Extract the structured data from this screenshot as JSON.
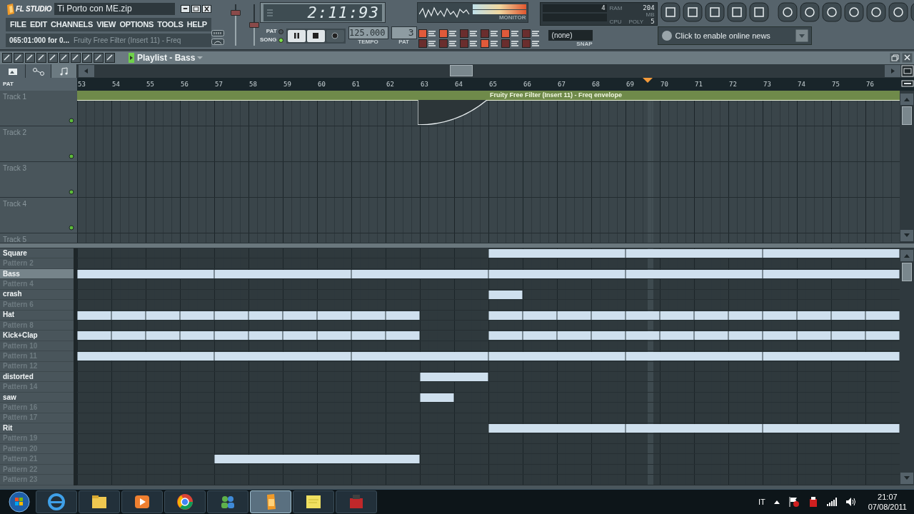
{
  "window": {
    "title": "Ti Porto con ME.zip"
  },
  "logo": "FL STUDIO",
  "menu": [
    "FILE",
    "EDIT",
    "CHANNELS",
    "VIEW",
    "OPTIONS",
    "TOOLS",
    "HELP"
  ],
  "hint": {
    "position": "065:01:000 for 0...",
    "message": "Fruity Free Filter (Insert 11) - Freq"
  },
  "sliders": [
    {
      "level": 0.8
    },
    {
      "level": 0.5
    }
  ],
  "time_display": "2:11:93",
  "mode": [
    {
      "label": "PAT",
      "selected": false
    },
    {
      "label": "SONG",
      "selected": true
    }
  ],
  "tempo": {
    "value": "125.000",
    "label": "TEMPO"
  },
  "pattern": {
    "value": "3",
    "label": "PAT"
  },
  "monitor": {
    "label": "MONITOR"
  },
  "stats": {
    "volume": "4",
    "ram_label": "RAM",
    "ram_unit": "MB",
    "ram_value": "204",
    "cpu_label": "CPU",
    "poly_label": "POLY",
    "poly_value": "5"
  },
  "snap": {
    "value": "(none)",
    "label": "SNAP"
  },
  "news": {
    "text": "Click to enable online news"
  },
  "playlist": {
    "title": "Playlist - Bass",
    "view_tabs": [
      {
        "kind": "picture",
        "selected": false
      },
      {
        "kind": "automation",
        "selected": false
      },
      {
        "kind": "note",
        "selected": true
      }
    ],
    "mode_label": "PAT",
    "ruler": [
      "53",
      "54",
      "55",
      "56",
      "57",
      "58",
      "59",
      "60",
      "61",
      "62",
      "63",
      "64",
      "65",
      "66",
      "67",
      "68",
      "69",
      "70",
      "71",
      "72",
      "73",
      "74",
      "75",
      "76"
    ],
    "playhead": {
      "level": 0.694
    },
    "tracks": [
      {
        "name": "Track 1",
        "bars": [
          {
            "kind": "start"
          },
          {
            "kind": "more"
          },
          {
            "kind": "more"
          },
          {
            "kind": "more"
          },
          {
            "kind": "more"
          },
          {
            "kind": "more"
          },
          {
            "kind": "more"
          },
          {
            "kind": "more"
          },
          {
            "kind": "more"
          },
          {
            "kind": "more"
          },
          {
            "kind": "more"
          },
          {
            "kind": "more"
          },
          {
            "kind": "start",
            "label": "Fruity Free Filter (Insert 11) - Freq envelope"
          },
          {
            "kind": "more"
          },
          {
            "kind": "more"
          },
          {
            "kind": "more"
          },
          {
            "kind": "more"
          },
          {
            "kind": "more"
          },
          {
            "kind": "more"
          },
          {
            "kind": "more"
          },
          {
            "kind": "more"
          },
          {
            "kind": "more"
          },
          {
            "kind": "more"
          },
          {
            "kind": "more"
          }
        ]
      },
      {
        "name": "Track 2"
      },
      {
        "name": "Track 3"
      },
      {
        "name": "Track 4"
      },
      {
        "name": "Track 5"
      }
    ],
    "patterns": [
      {
        "name": "Square",
        "named": true,
        "selected": false,
        "bars": [
          {
            "kind": "empty"
          },
          {
            "kind": "empty"
          },
          {
            "kind": "empty"
          },
          {
            "kind": "empty"
          },
          {
            "kind": "empty"
          },
          {
            "kind": "empty"
          },
          {
            "kind": "empty"
          },
          {
            "kind": "empty"
          },
          {
            "kind": "empty"
          },
          {
            "kind": "empty"
          },
          {
            "kind": "empty"
          },
          {
            "kind": "empty"
          },
          {
            "kind": "start"
          },
          {
            "kind": "more"
          },
          {
            "kind": "more"
          },
          {
            "kind": "more"
          },
          {
            "kind": "start"
          },
          {
            "kind": "more"
          },
          {
            "kind": "more"
          },
          {
            "kind": "more"
          },
          {
            "kind": "start"
          },
          {
            "kind": "more"
          },
          {
            "kind": "more"
          },
          {
            "kind": "more"
          }
        ]
      },
      {
        "name": "Pattern 2",
        "named": false,
        "selected": false
      },
      {
        "name": "Bass",
        "named": true,
        "selected": true,
        "bars": [
          {
            "kind": "start"
          },
          {
            "kind": "more"
          },
          {
            "kind": "more"
          },
          {
            "kind": "more"
          },
          {
            "kind": "start"
          },
          {
            "kind": "more"
          },
          {
            "kind": "more"
          },
          {
            "kind": "more"
          },
          {
            "kind": "start"
          },
          {
            "kind": "more"
          },
          {
            "kind": "more"
          },
          {
            "kind": "more"
          },
          {
            "kind": "start"
          },
          {
            "kind": "more"
          },
          {
            "kind": "more"
          },
          {
            "kind": "more"
          },
          {
            "kind": "start"
          },
          {
            "kind": "more"
          },
          {
            "kind": "more"
          },
          {
            "kind": "more"
          },
          {
            "kind": "start"
          },
          {
            "kind": "more"
          },
          {
            "kind": "more"
          },
          {
            "kind": "more"
          }
        ]
      },
      {
        "name": "Pattern 4",
        "named": false,
        "selected": false
      },
      {
        "name": "crash",
        "named": true,
        "selected": false,
        "bars": [
          {
            "kind": "empty"
          },
          {
            "kind": "empty"
          },
          {
            "kind": "empty"
          },
          {
            "kind": "empty"
          },
          {
            "kind": "empty"
          },
          {
            "kind": "empty"
          },
          {
            "kind": "empty"
          },
          {
            "kind": "empty"
          },
          {
            "kind": "empty"
          },
          {
            "kind": "empty"
          },
          {
            "kind": "empty"
          },
          {
            "kind": "empty"
          },
          {
            "kind": "start"
          },
          {
            "kind": "empty"
          },
          {
            "kind": "empty"
          },
          {
            "kind": "empty"
          },
          {
            "kind": "empty"
          },
          {
            "kind": "empty"
          },
          {
            "kind": "empty"
          },
          {
            "kind": "empty"
          },
          {
            "kind": "empty"
          },
          {
            "kind": "empty"
          },
          {
            "kind": "empty"
          },
          {
            "kind": "empty"
          }
        ]
      },
      {
        "name": "Pattern 6",
        "named": false,
        "selected": false
      },
      {
        "name": "Hat",
        "named": true,
        "selected": false,
        "bars": [
          {
            "kind": "start"
          },
          {
            "kind": "start"
          },
          {
            "kind": "start"
          },
          {
            "kind": "start"
          },
          {
            "kind": "start"
          },
          {
            "kind": "start"
          },
          {
            "kind": "start"
          },
          {
            "kind": "start"
          },
          {
            "kind": "start"
          },
          {
            "kind": "start"
          },
          {
            "kind": "empty"
          },
          {
            "kind": "empty"
          },
          {
            "kind": "start"
          },
          {
            "kind": "start"
          },
          {
            "kind": "start"
          },
          {
            "kind": "start"
          },
          {
            "kind": "start"
          },
          {
            "kind": "start"
          },
          {
            "kind": "start"
          },
          {
            "kind": "start"
          },
          {
            "kind": "start"
          },
          {
            "kind": "start"
          },
          {
            "kind": "start"
          },
          {
            "kind": "start"
          }
        ]
      },
      {
        "name": "Pattern 8",
        "named": false,
        "selected": false
      },
      {
        "name": "Kick+Clap",
        "named": true,
        "selected": false,
        "bars": [
          {
            "kind": "start"
          },
          {
            "kind": "start"
          },
          {
            "kind": "start"
          },
          {
            "kind": "start"
          },
          {
            "kind": "start"
          },
          {
            "kind": "start"
          },
          {
            "kind": "start"
          },
          {
            "kind": "start"
          },
          {
            "kind": "start"
          },
          {
            "kind": "start"
          },
          {
            "kind": "empty"
          },
          {
            "kind": "empty"
          },
          {
            "kind": "start"
          },
          {
            "kind": "start"
          },
          {
            "kind": "start"
          },
          {
            "kind": "start"
          },
          {
            "kind": "start"
          },
          {
            "kind": "start"
          },
          {
            "kind": "start"
          },
          {
            "kind": "start"
          },
          {
            "kind": "start"
          },
          {
            "kind": "start"
          },
          {
            "kind": "start"
          },
          {
            "kind": "start"
          }
        ]
      },
      {
        "name": "Pattern 10",
        "named": false,
        "selected": false
      },
      {
        "name": "Pattern 11",
        "named": false,
        "selected": false,
        "bars": [
          {
            "kind": "start"
          },
          {
            "kind": "more"
          },
          {
            "kind": "more"
          },
          {
            "kind": "more"
          },
          {
            "kind": "start"
          },
          {
            "kind": "more"
          },
          {
            "kind": "more"
          },
          {
            "kind": "more"
          },
          {
            "kind": "start"
          },
          {
            "kind": "more"
          },
          {
            "kind": "more"
          },
          {
            "kind": "more"
          },
          {
            "kind": "start"
          },
          {
            "kind": "more"
          },
          {
            "kind": "more"
          },
          {
            "kind": "more"
          },
          {
            "kind": "start"
          },
          {
            "kind": "more"
          },
          {
            "kind": "more"
          },
          {
            "kind": "more"
          },
          {
            "kind": "start"
          },
          {
            "kind": "more"
          },
          {
            "kind": "more"
          },
          {
            "kind": "more"
          }
        ]
      },
      {
        "name": "Pattern 12",
        "named": false,
        "selected": false
      },
      {
        "name": "distorted",
        "named": true,
        "selected": false,
        "bars": [
          {
            "kind": "empty"
          },
          {
            "kind": "empty"
          },
          {
            "kind": "empty"
          },
          {
            "kind": "empty"
          },
          {
            "kind": "empty"
          },
          {
            "kind": "empty"
          },
          {
            "kind": "empty"
          },
          {
            "kind": "empty"
          },
          {
            "kind": "empty"
          },
          {
            "kind": "empty"
          },
          {
            "kind": "start"
          },
          {
            "kind": "more"
          },
          {
            "kind": "empty"
          },
          {
            "kind": "empty"
          },
          {
            "kind": "empty"
          },
          {
            "kind": "empty"
          },
          {
            "kind": "empty"
          },
          {
            "kind": "empty"
          },
          {
            "kind": "empty"
          },
          {
            "kind": "empty"
          },
          {
            "kind": "empty"
          },
          {
            "kind": "empty"
          },
          {
            "kind": "empty"
          },
          {
            "kind": "empty"
          }
        ]
      },
      {
        "name": "Pattern 14",
        "named": false,
        "selected": false
      },
      {
        "name": "saw",
        "named": true,
        "selected": false,
        "bars": [
          {
            "kind": "empty"
          },
          {
            "kind": "empty"
          },
          {
            "kind": "empty"
          },
          {
            "kind": "empty"
          },
          {
            "kind": "empty"
          },
          {
            "kind": "empty"
          },
          {
            "kind": "empty"
          },
          {
            "kind": "empty"
          },
          {
            "kind": "empty"
          },
          {
            "kind": "empty"
          },
          {
            "kind": "start"
          },
          {
            "kind": "empty"
          },
          {
            "kind": "empty"
          },
          {
            "kind": "empty"
          },
          {
            "kind": "empty"
          },
          {
            "kind": "empty"
          },
          {
            "kind": "empty"
          },
          {
            "kind": "empty"
          },
          {
            "kind": "empty"
          },
          {
            "kind": "empty"
          },
          {
            "kind": "empty"
          },
          {
            "kind": "empty"
          },
          {
            "kind": "empty"
          },
          {
            "kind": "empty"
          }
        ]
      },
      {
        "name": "Pattern 16",
        "named": false,
        "selected": false
      },
      {
        "name": "Pattern 17",
        "named": false,
        "selected": false
      },
      {
        "name": "Rit",
        "named": true,
        "selected": false,
        "bars": [
          {
            "kind": "empty"
          },
          {
            "kind": "empty"
          },
          {
            "kind": "empty"
          },
          {
            "kind": "empty"
          },
          {
            "kind": "empty"
          },
          {
            "kind": "empty"
          },
          {
            "kind": "empty"
          },
          {
            "kind": "empty"
          },
          {
            "kind": "empty"
          },
          {
            "kind": "empty"
          },
          {
            "kind": "empty"
          },
          {
            "kind": "empty"
          },
          {
            "kind": "start"
          },
          {
            "kind": "more"
          },
          {
            "kind": "more"
          },
          {
            "kind": "more"
          },
          {
            "kind": "start"
          },
          {
            "kind": "more"
          },
          {
            "kind": "more"
          },
          {
            "kind": "more"
          },
          {
            "kind": "start"
          },
          {
            "kind": "more"
          },
          {
            "kind": "more"
          },
          {
            "kind": "more"
          }
        ]
      },
      {
        "name": "Pattern 19",
        "named": false,
        "selected": false
      },
      {
        "name": "Pattern 20",
        "named": false,
        "selected": false
      },
      {
        "name": "Pattern 21",
        "named": false,
        "selected": false,
        "bars": [
          {
            "kind": "empty"
          },
          {
            "kind": "empty"
          },
          {
            "kind": "empty"
          },
          {
            "kind": "empty"
          },
          {
            "kind": "start"
          },
          {
            "kind": "more"
          },
          {
            "kind": "more"
          },
          {
            "kind": "more"
          },
          {
            "kind": "more"
          },
          {
            "kind": "more"
          },
          {
            "kind": "empty"
          },
          {
            "kind": "empty"
          },
          {
            "kind": "empty"
          },
          {
            "kind": "empty"
          },
          {
            "kind": "empty"
          },
          {
            "kind": "empty"
          },
          {
            "kind": "empty"
          },
          {
            "kind": "empty"
          },
          {
            "kind": "empty"
          },
          {
            "kind": "empty"
          },
          {
            "kind": "empty"
          },
          {
            "kind": "empty"
          },
          {
            "kind": "empty"
          },
          {
            "kind": "empty"
          }
        ]
      },
      {
        "name": "Pattern 22",
        "named": false,
        "selected": false
      },
      {
        "name": "Pattern 23",
        "named": false,
        "selected": false
      }
    ]
  },
  "taskbar": {
    "apps": [
      {
        "kind": "browser-e",
        "selected": false
      },
      {
        "kind": "folder",
        "selected": false
      },
      {
        "kind": "player",
        "selected": false
      },
      {
        "kind": "browser-ring",
        "selected": false
      },
      {
        "kind": "people",
        "selected": false
      },
      {
        "kind": "fruit",
        "selected": true
      },
      {
        "kind": "note",
        "selected": false
      },
      {
        "kind": "recorder",
        "selected": false
      }
    ],
    "language": "IT",
    "time": "21:07",
    "date": "07/08/2011"
  }
}
